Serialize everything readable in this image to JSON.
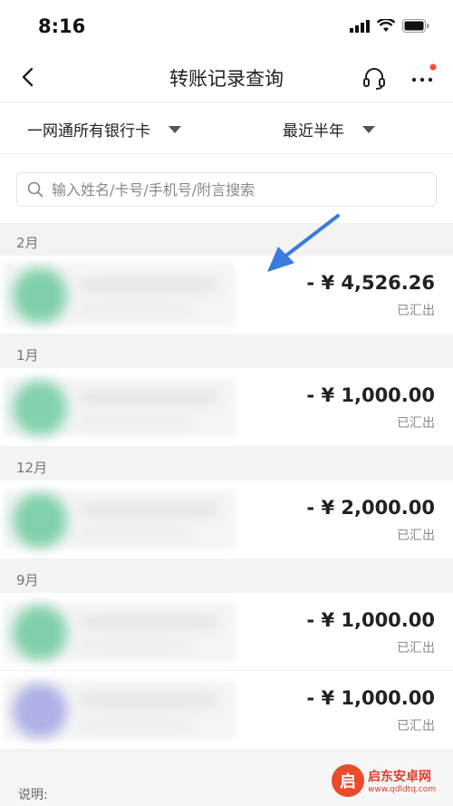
{
  "status_bar": {
    "time": "8:16"
  },
  "nav": {
    "title": "转账记录查询",
    "back_icon": "chevron-left-icon",
    "service_icon": "headset-icon",
    "more_icon": "more-dots-icon",
    "badge_color": "#ff4a3d"
  },
  "filters": {
    "account": "一网通所有银行卡",
    "period": "最近半年"
  },
  "search": {
    "placeholder": "输入姓名/卡号/手机号/附言搜索"
  },
  "groups": [
    {
      "month": "2月",
      "records": [
        {
          "amount": "- ¥ 4,526.26",
          "status": "已汇出"
        }
      ]
    },
    {
      "month": "1月",
      "records": [
        {
          "amount": "- ¥ 1,000.00",
          "status": "已汇出"
        }
      ]
    },
    {
      "month": "12月",
      "records": [
        {
          "amount": "- ¥ 2,000.00",
          "status": "已汇出"
        }
      ]
    },
    {
      "month": "9月",
      "records": [
        {
          "amount": "- ¥ 1,000.00",
          "status": "已汇出"
        },
        {
          "amount": "- ¥ 1,000.00",
          "status": "已汇出"
        }
      ]
    }
  ],
  "footer": {
    "note_label": "说明:"
  },
  "watermark": {
    "name": "启东安卓网",
    "url": "www.qdldtq.com"
  },
  "colors": {
    "avatar_green": "#7fcfaa",
    "avatar_purple": "#aeb0e6",
    "annotation_arrow": "#3a7be0"
  }
}
